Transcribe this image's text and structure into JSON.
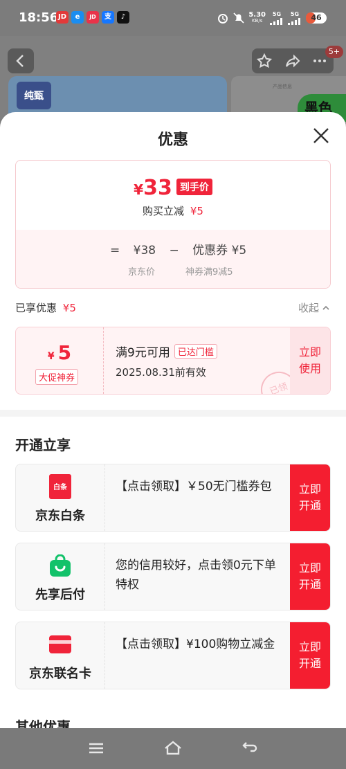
{
  "status_bar": {
    "time": "18:56",
    "apps": [
      {
        "name": "jd-app-icon",
        "label": "JD",
        "color": "#e23a3a"
      },
      {
        "name": "e-app-icon",
        "label": "e",
        "color": "#1a8df0"
      },
      {
        "name": "jd-finance-app-icon",
        "label": "JD",
        "color": "#e8334a"
      },
      {
        "name": "alipay-app-icon",
        "label": "支",
        "color": "#1677ff"
      },
      {
        "name": "tiktok-app-icon",
        "label": "♪",
        "color": "#111111"
      }
    ],
    "speed_value": "5.30",
    "speed_unit": "KB/s",
    "signal1": "5G",
    "signal2": "5G",
    "battery": "46"
  },
  "background": {
    "brand_badge": "纯甄",
    "banner_text": "黑色",
    "notify_badge": "5+",
    "product_info": "产品信息"
  },
  "sheet": {
    "title": "优惠",
    "price_box": {
      "currency": "¥",
      "final_price": "33",
      "final_tag": "到手价",
      "instant_reduce_label": "购买立减",
      "instant_reduce_value": "¥5",
      "equals": "=",
      "jd_price": "¥38",
      "minus": "−",
      "coupon_label": "优惠券 ¥5",
      "jd_price_caption": "京东价",
      "coupon_caption": "神券满9减5"
    },
    "enjoyed": {
      "label": "已享优惠",
      "value": "¥5",
      "collapse": "收起"
    },
    "coupon": {
      "currency": "¥",
      "amount": "5",
      "type": "大促神券",
      "condition": "满9元可用",
      "threshold_tag": "已达门槛",
      "expiry": "2025.08.31前有效",
      "use_button_line1": "立即",
      "use_button_line2": "使用",
      "stamp": "已领"
    },
    "open_section_title": "开通立享",
    "cards": [
      {
        "name": "京东白条",
        "icon_text": "白条",
        "desc": "【点击领取】￥50无门槛券包",
        "btn1": "立即",
        "btn2": "开通"
      },
      {
        "name": "先享后付",
        "icon_text": "",
        "desc": "您的信用较好，点击领0元下单特权",
        "btn1": "立即",
        "btn2": "开通"
      },
      {
        "name": "京东联名卡",
        "icon_text": "",
        "desc": "【点击领取】¥100购物立减金",
        "btn1": "立即",
        "btn2": "开通"
      }
    ],
    "other_section_title": "其他优惠"
  }
}
